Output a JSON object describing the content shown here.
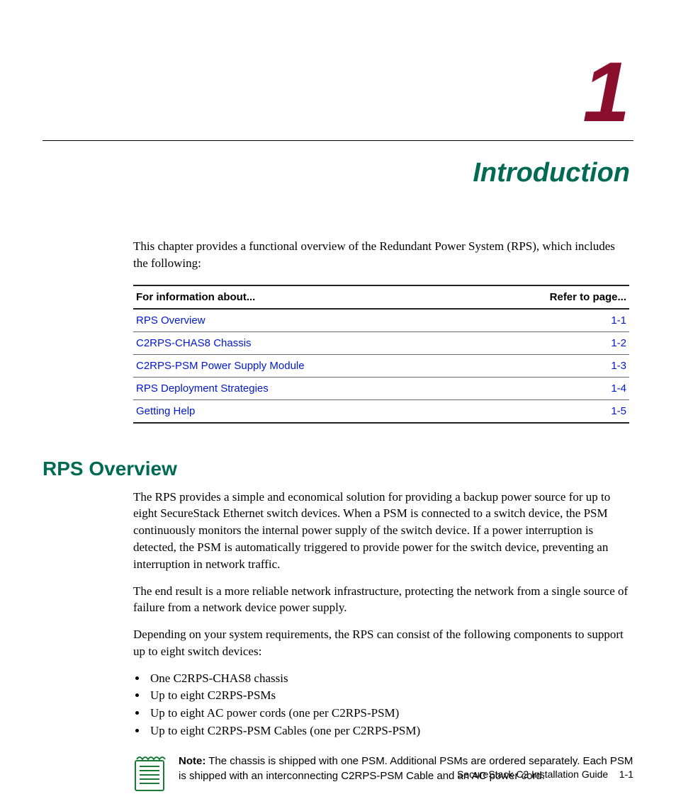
{
  "chapterNumber": "1",
  "chapterTitle": "Introduction",
  "introParagraph": "This chapter provides a functional overview of the Redundant Power System (RPS), which includes the following:",
  "toc": {
    "head": {
      "left": "For information about...",
      "right": "Refer to page..."
    },
    "rows": [
      {
        "label": "RPS Overview",
        "page": "1-1"
      },
      {
        "label": "C2RPS-CHAS8 Chassis",
        "page": "1-2"
      },
      {
        "label": "C2RPS-PSM Power Supply Module",
        "page": "1-3"
      },
      {
        "label": "RPS Deployment Strategies",
        "page": "1-4"
      },
      {
        "label": "Getting Help",
        "page": "1-5"
      }
    ]
  },
  "sectionTitle": "RPS Overview",
  "paragraphs": [
    "The RPS provides a simple and economical solution for providing a backup power source for up to eight SecureStack Ethernet switch devices. When a PSM is connected to a switch device, the PSM continuously monitors the internal power supply of the switch device. If a power interruption is detected, the PSM is automatically triggered to provide power for the switch device, preventing an interruption in network traffic.",
    "The end result is a more reliable network infrastructure, protecting the network from a single source of failure from a network device power supply.",
    "Depending on your system requirements, the RPS can consist of the following components to support up to eight switch devices:"
  ],
  "bullets": [
    "One C2RPS‑CHAS8 chassis",
    "Up to eight C2RPS‑PSMs",
    "Up to eight AC power cords (one per C2RPS‑PSM)",
    "Up to eight C2RPS‑PSM Cables (one per C2RPS‑PSM)"
  ],
  "note": {
    "label": "Note:",
    "text": "The chassis is shipped with one PSM. Additional PSMs are ordered separately. Each PSM is shipped with an interconnecting C2RPS‑PSM Cable and an AC power cord."
  },
  "footer": {
    "docTitle": "SecureStack C2 Installation Guide",
    "pageNum": "1-1"
  }
}
